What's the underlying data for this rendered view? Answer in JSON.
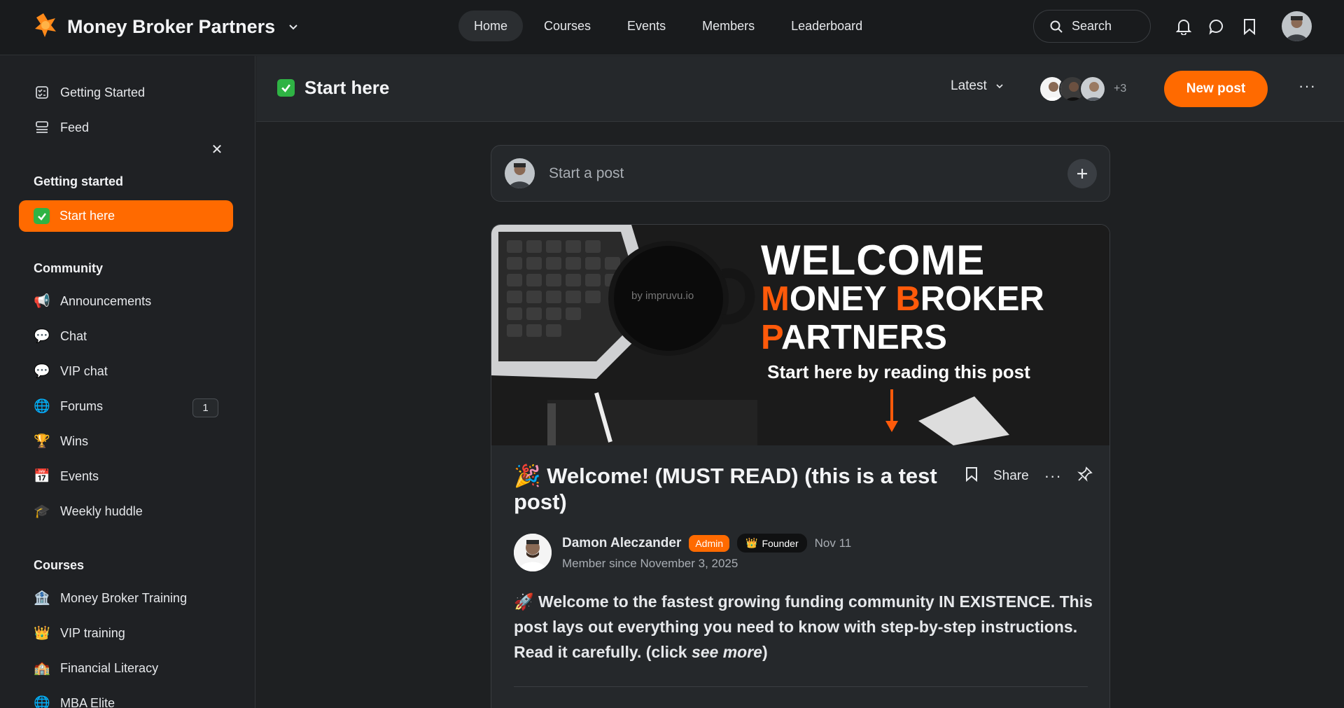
{
  "header": {
    "app_name": "Money Broker Partners",
    "nav": [
      "Home",
      "Courses",
      "Events",
      "Members",
      "Leaderboard"
    ],
    "active_nav": "Home",
    "search_label": "Search"
  },
  "sidebar": {
    "top_items": [
      {
        "label": "Getting Started",
        "icon": "checklist-icon"
      },
      {
        "label": "Feed",
        "icon": "feed-icon"
      }
    ],
    "sections": [
      {
        "heading": "Getting started",
        "items": [
          {
            "label": "Start here",
            "icon": "check-emoji",
            "active": true
          }
        ]
      },
      {
        "heading": "Community",
        "items": [
          {
            "label": "Announcements",
            "icon": "megaphone-emoji"
          },
          {
            "label": "Chat",
            "icon": "speech-bubble-emoji"
          },
          {
            "label": "VIP chat",
            "icon": "speech-bubble-emoji"
          },
          {
            "label": "Forums",
            "icon": "globe-emoji",
            "count": "1"
          },
          {
            "label": "Wins",
            "icon": "trophy-emoji"
          },
          {
            "label": "Events",
            "icon": "calendar-emoji"
          },
          {
            "label": "Weekly huddle",
            "icon": "graduation-cap-emoji"
          }
        ]
      },
      {
        "heading": "Courses",
        "items": [
          {
            "label": "Money Broker Training",
            "icon": "bank-emoji"
          },
          {
            "label": "VIP training",
            "icon": "crown-emoji"
          },
          {
            "label": "Financial Literacy",
            "icon": "school-emoji"
          },
          {
            "label": "MBA Elite",
            "icon": "globe-emoji"
          }
        ]
      }
    ]
  },
  "page": {
    "title": "Start here",
    "sort_label": "Latest",
    "members_more": "+3",
    "new_post_label": "New post"
  },
  "composer": {
    "placeholder": "Start a post"
  },
  "post": {
    "banner": {
      "line1": "WELCOME",
      "line2_m": "M",
      "line2_a": "ONEY ",
      "line2_b": "B",
      "line2_c": "ROKER",
      "line3_p": "P",
      "line3_rest": "ARTNERS",
      "subtitle": "Start here by reading this post",
      "mug_text": "by impruvu.io"
    },
    "title": "🎉 Welcome! (MUST READ) (this is a test post)",
    "share_label": "Share",
    "author": {
      "name": "Damon Aleczander",
      "admin_tag": "Admin",
      "founder_tag": "Founder",
      "date": "Nov 11",
      "member_since": "Member since November 3, 2025"
    },
    "body_main": "🚀 Welcome to the fastest growing funding community IN EXISTENCE. This post lays out everything you need to know with step-by-step instructions. Read it carefully. (click ",
    "body_em": "see more",
    "body_end": ")"
  },
  "colors": {
    "accent": "#ff6a00",
    "background": "#1e2022",
    "surface": "#25282b",
    "success": "#2fb344"
  }
}
